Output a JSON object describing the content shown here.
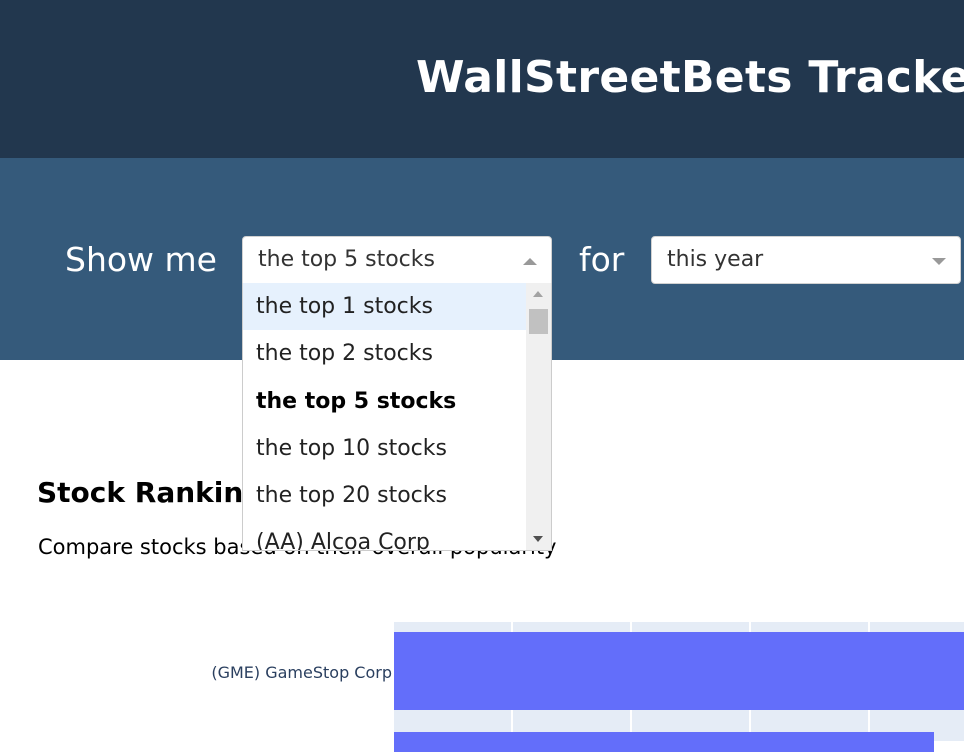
{
  "header": {
    "title": "WallStreetBets Tracker"
  },
  "controls": {
    "show_me_label": "Show me",
    "for_label": "for",
    "count_select": {
      "value": "the top 5 stocks",
      "options": [
        "the top 1 stocks",
        "the top 2 stocks",
        "the top 5 stocks",
        "the top 10 stocks",
        "the top 20 stocks",
        "(AA) Alcoa Corp"
      ],
      "highlighted": "the top 1 stocks",
      "selected": "the top 5 stocks"
    },
    "period_select": {
      "value": "this year"
    }
  },
  "section": {
    "title": "Stock Rankings",
    "description": "Compare stocks based on their overall popularity"
  },
  "chart_data": {
    "type": "bar",
    "orientation": "horizontal",
    "categories": [
      "(GME) GameStop Corp"
    ],
    "bar_color": "#636efa",
    "plot_background": "#e5ecf6"
  },
  "colors": {
    "header_bg": "#22374e",
    "controls_bg": "#355a7b",
    "bar": "#636efa"
  }
}
